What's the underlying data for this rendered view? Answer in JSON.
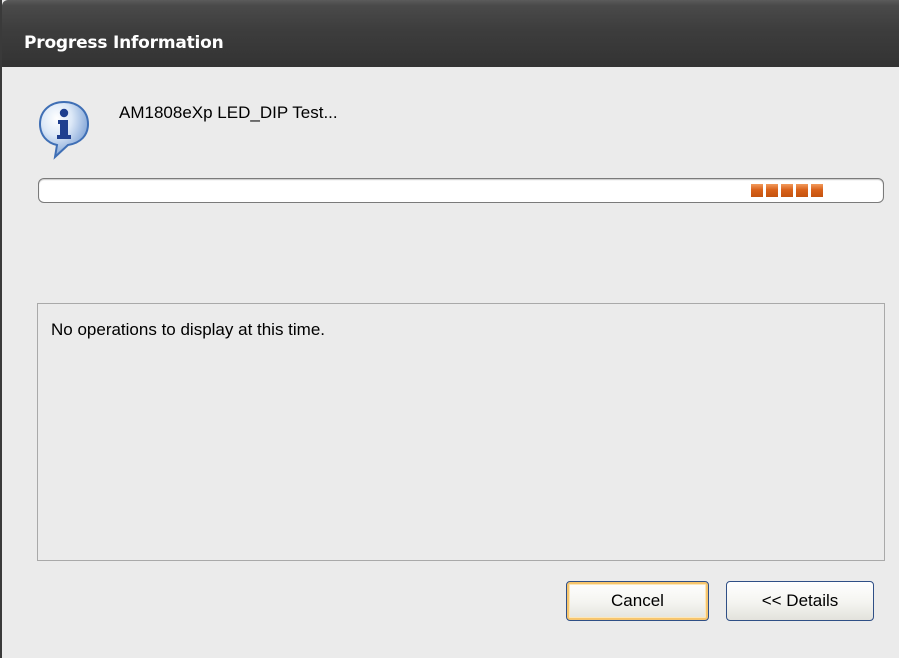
{
  "window": {
    "title": "Progress Information"
  },
  "message": {
    "text": "AM1808eXp LED_DIP Test..."
  },
  "progress": {
    "mode": "indeterminate",
    "chunk_count": 5,
    "chunk_color": "#d9621a"
  },
  "details": {
    "text": "No operations to display at this time."
  },
  "buttons": {
    "cancel_label": "Cancel",
    "details_label": "<< Details"
  },
  "icons": {
    "info": "info-icon"
  },
  "colors": {
    "titlebar": "#3d3d3d",
    "dialog_background": "#ebebeb",
    "progress_chunk": "#d9621a",
    "default_button_focus": "#f6c56e"
  }
}
